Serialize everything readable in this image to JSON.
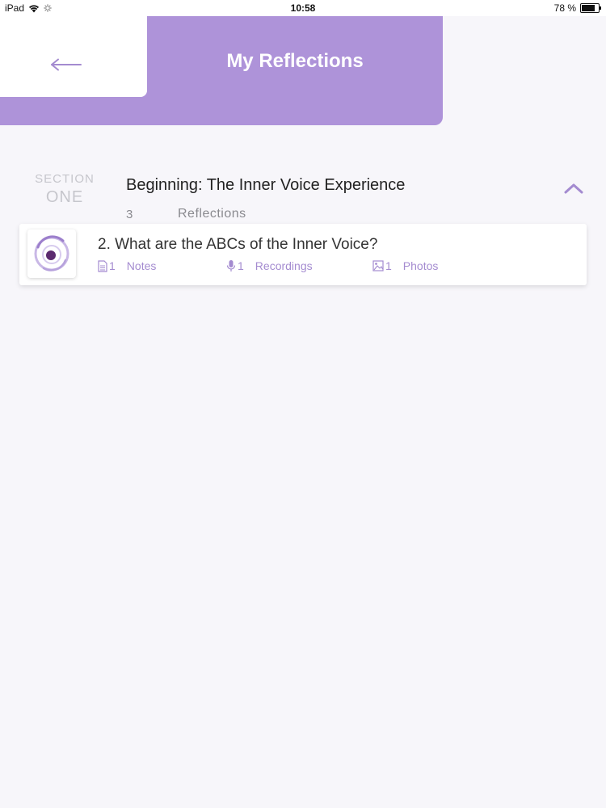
{
  "status_bar": {
    "device": "iPad",
    "time": "10:58",
    "battery": "78 %",
    "battery_level": 0.78
  },
  "header": {
    "title": "My Reflections",
    "back_icon": "arrow-left-icon"
  },
  "section": {
    "label_top": "SECTION",
    "label_bottom": "ONE",
    "title": "Beginning: The Inner Voice Experience",
    "count": "3",
    "count_label": "Reflections",
    "toggle_icon": "chevron-up-icon"
  },
  "reflection": {
    "title": "2. What are the ABCs of the Inner Voice?",
    "notes_count": "1",
    "notes_label": "Notes",
    "recordings_count": "1",
    "recordings_label": "Recordings",
    "photos_count": "1",
    "photos_label": "Photos"
  },
  "colors": {
    "accent": "#ae93d9",
    "accent_text": "#a48bd0",
    "background": "#f7f6fa"
  }
}
